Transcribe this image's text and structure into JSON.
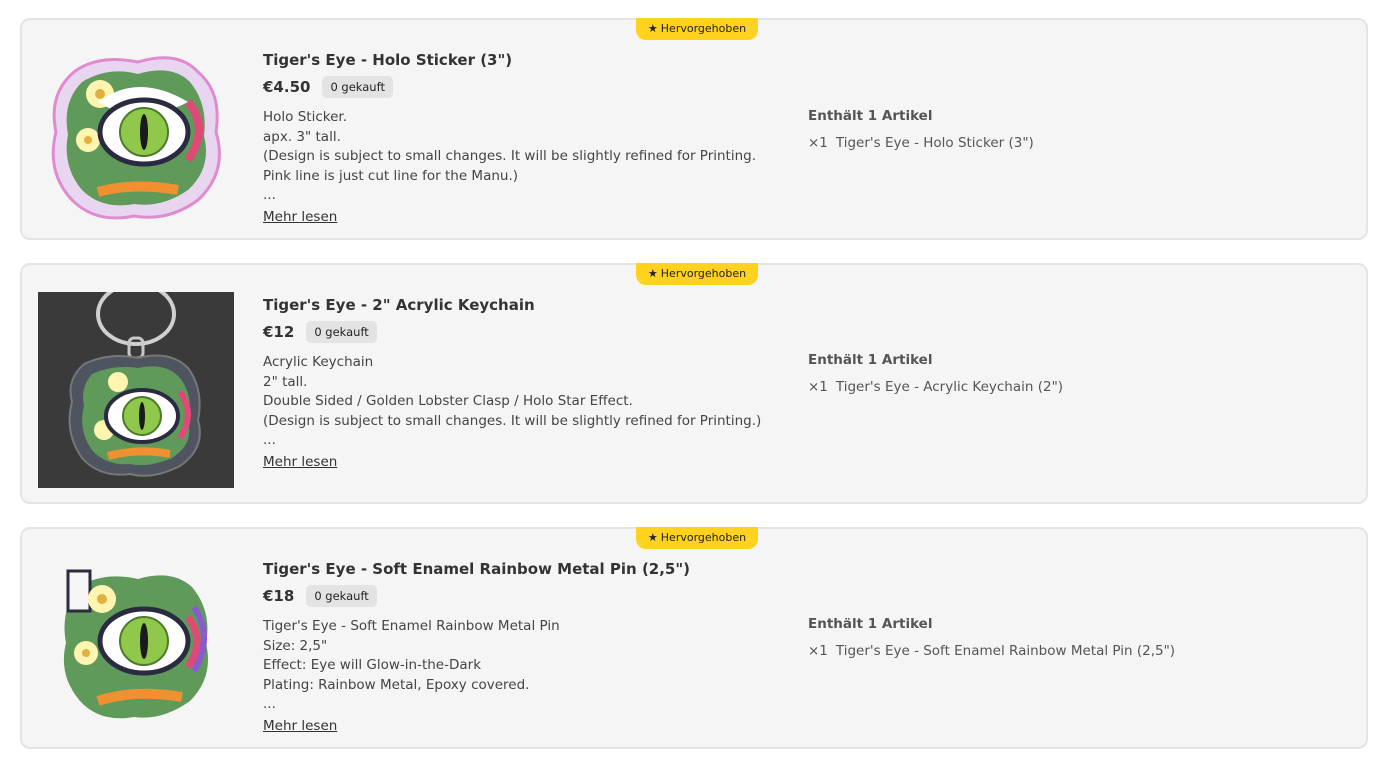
{
  "products": [
    {
      "badge": "Hervorgehoben",
      "title": "Tiger's Eye - Holo Sticker (3\")",
      "price": "€4.50",
      "sold": "0 gekauft",
      "desc": [
        "Holo Sticker.",
        "apx. 3\" tall.",
        "(Design is subject to small changes. It will be slightly refined for Printing. Pink line is just cut line for the Manu.)",
        "..."
      ],
      "more": "Mehr lesen",
      "contents_title": "Enthält 1 Artikel",
      "item_qty": "×1",
      "item_name": "Tiger's Eye - Holo Sticker (3\")",
      "image": "sticker-image"
    },
    {
      "badge": "Hervorgehoben",
      "title": "Tiger's Eye - 2\" Acrylic Keychain",
      "price": "€12",
      "sold": "0 gekauft",
      "desc": [
        "Acrylic Keychain",
        "2\" tall.",
        "Double Sided / Golden Lobster Clasp / Holo Star Effect.",
        "(Design is subject to small changes. It will be slightly refined for Printing.)",
        "..."
      ],
      "more": "Mehr lesen",
      "contents_title": "Enthält 1 Artikel",
      "item_qty": "×1",
      "item_name": "Tiger's Eye - Acrylic Keychain (2\")",
      "image": "keychain-image"
    },
    {
      "badge": "Hervorgehoben",
      "title": "Tiger's Eye - Soft Enamel Rainbow Metal Pin (2,5\")",
      "price": "€18",
      "sold": "0 gekauft",
      "desc": [
        "Tiger's Eye - Soft Enamel Rainbow Metal Pin",
        "Size: 2,5\"",
        "Effect: Eye will Glow-in-the-Dark",
        "Plating: Rainbow Metal, Epoxy covered.",
        "..."
      ],
      "more": "Mehr lesen",
      "contents_title": "Enthält 1 Artikel",
      "item_qty": "×1",
      "item_name": "Tiger's Eye - Soft Enamel Rainbow Metal Pin (2,5\")",
      "image": "pin-image"
    }
  ],
  "colors": {
    "badge_bg": "#ffd21f",
    "card_bg": "#f5f5f5",
    "sold_bg": "#e3e3e3",
    "keychain_bg": "#3a3a3a",
    "eye_green": "#8fc84a"
  }
}
